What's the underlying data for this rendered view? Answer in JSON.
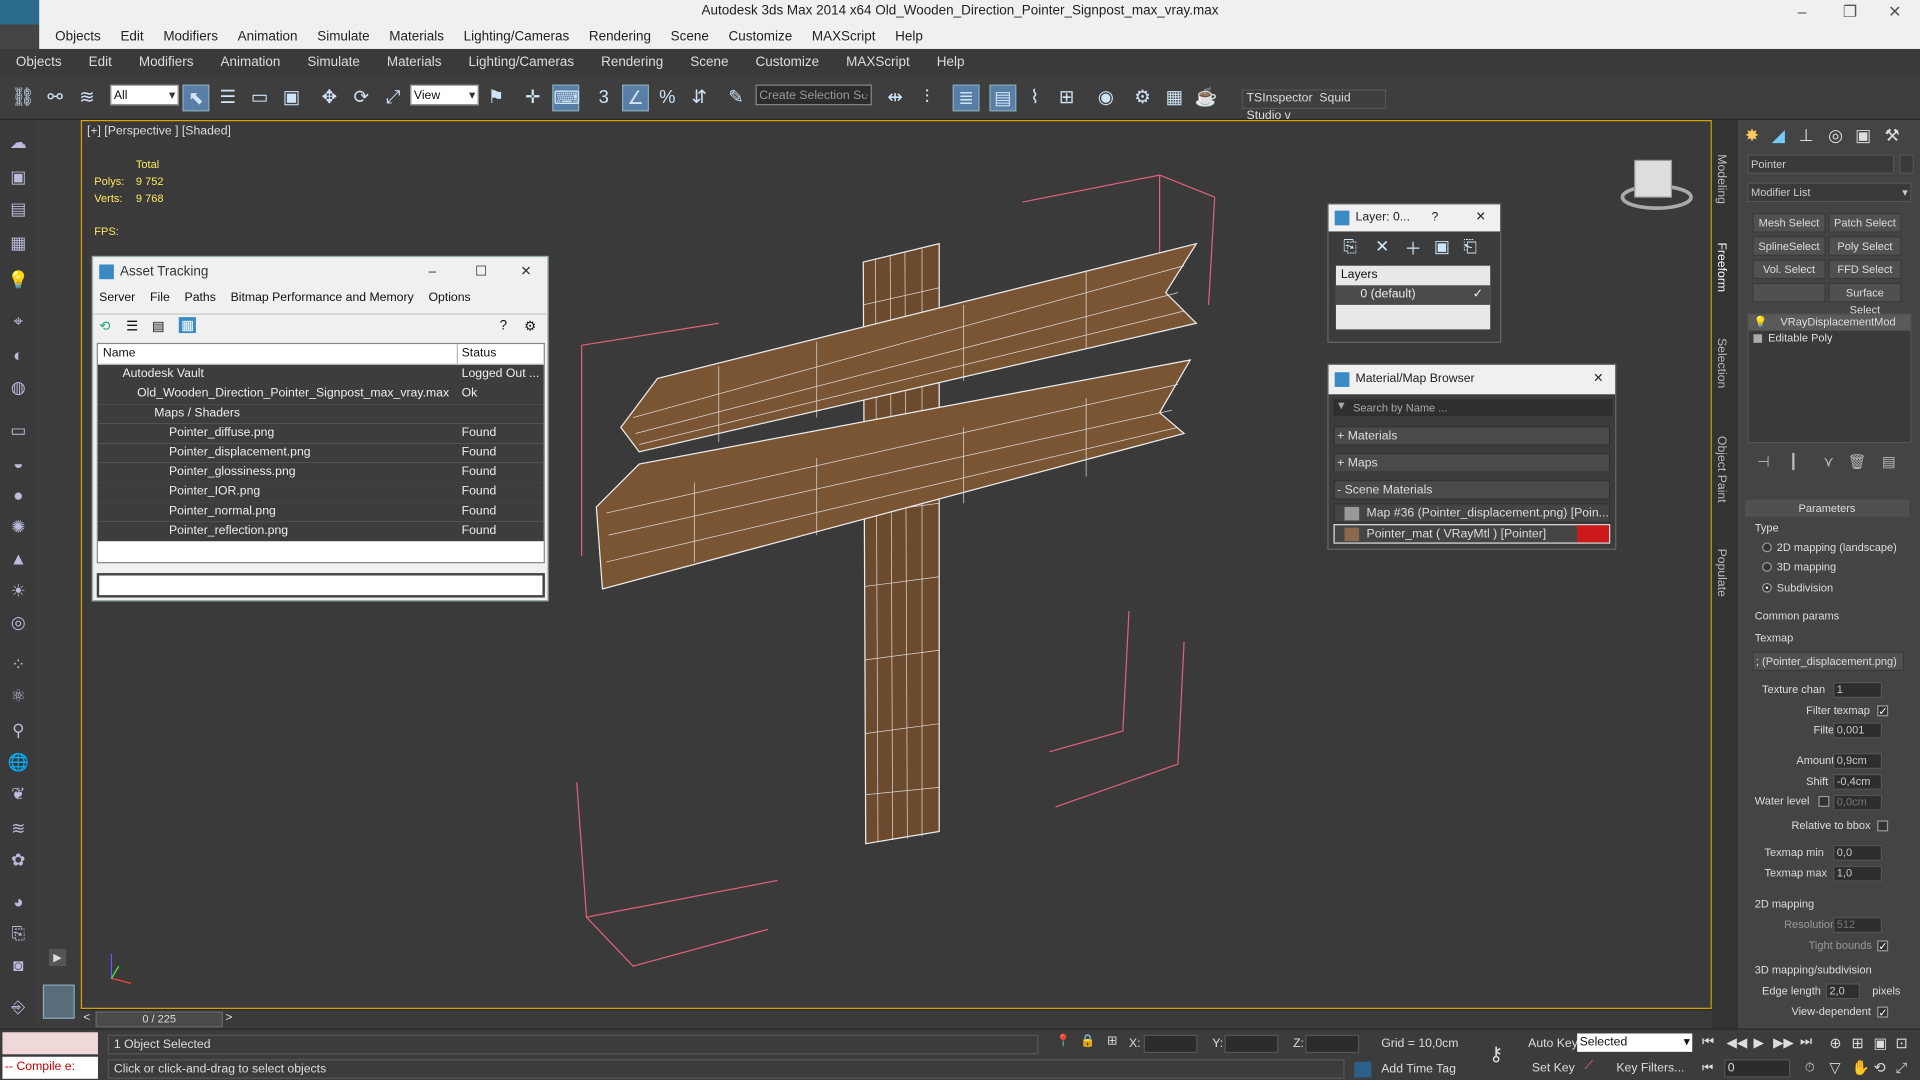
{
  "window": {
    "title": "Autodesk 3ds Max  2014 x64    Old_Wooden_Direction_Pointer_Signpost_max_vray.max"
  },
  "menu_top": [
    "Objects",
    "Edit",
    "Modifiers",
    "Animation",
    "Simulate",
    "Materials",
    "Lighting/Cameras",
    "Rendering",
    "Scene",
    "Customize",
    "MAXScript",
    "Help"
  ],
  "menu_main": [
    "Objects",
    "Edit",
    "Modifiers",
    "Animation",
    "Simulate",
    "Materials",
    "Lighting/Cameras",
    "Rendering",
    "Scene",
    "Customize",
    "MAXScript",
    "Help"
  ],
  "toolbar": {
    "filter_value": "All",
    "refcoord_value": "View",
    "selection_set_placeholder": "Create Selection Se",
    "tsinspector": "TSInspector",
    "squid": "Squid Studio v"
  },
  "viewport": {
    "label": "[+] [Perspective ] [Shaded]",
    "stats": {
      "total": "Total",
      "polys_label": "Polys:",
      "polys": "9 752",
      "verts_label": "Verts:",
      "verts": "9 768",
      "fps_label": "FPS:"
    }
  },
  "asset_tracking": {
    "title": "Asset Tracking",
    "menu": [
      "Server",
      "File",
      "Paths",
      "Bitmap Performance and Memory",
      "Options"
    ],
    "col_name": "Name",
    "col_status": "Status",
    "rows": [
      {
        "name": "Autodesk Vault",
        "status": "Logged Out ..."
      },
      {
        "name": "Old_Wooden_Direction_Pointer_Signpost_max_vray.max",
        "status": "Ok"
      },
      {
        "name": "Maps / Shaders",
        "status": ""
      },
      {
        "name": "Pointer_diffuse.png",
        "status": "Found"
      },
      {
        "name": "Pointer_displacement.png",
        "status": "Found"
      },
      {
        "name": "Pointer_glossiness.png",
        "status": "Found"
      },
      {
        "name": "Pointer_IOR.png",
        "status": "Found"
      },
      {
        "name": "Pointer_normal.png",
        "status": "Found"
      },
      {
        "name": "Pointer_reflection.png",
        "status": "Found"
      }
    ]
  },
  "layer_win": {
    "title": "Layer: 0...",
    "help": "?",
    "header": "Layers",
    "item": "0 (default)"
  },
  "mat_browser": {
    "title": "Material/Map Browser",
    "search_placeholder": "Search by Name ...",
    "groups": [
      "+ Materials",
      "+ Maps",
      "- Scene Materials"
    ],
    "items": [
      "Map #36 (Pointer_displacement.png) [Poin...",
      "Pointer_mat  ( VRayMtl ) [Pointer]"
    ]
  },
  "right_tabs": [
    "Modeling",
    "Freeform",
    "Selection",
    "Object Paint",
    "Populate"
  ],
  "cmd_panel": {
    "object_name": "Pointer",
    "modifier_list": "Modifier List",
    "buttons": [
      "Mesh Select",
      "Patch Select",
      "SplineSelect",
      "Poly Select",
      "Vol. Select",
      "FFD Select",
      "",
      "Surface Select"
    ],
    "stack": [
      "VRayDisplacementMod",
      "Editable Poly"
    ],
    "params_title": "Parameters",
    "type_label": "Type",
    "type_opts": [
      "2D mapping (landscape)",
      "3D mapping",
      "Subdivision"
    ],
    "common_label": "Common params",
    "texmap_label": "Texmap",
    "texmap_value": "; (Pointer_displacement.png)",
    "texture_chan_label": "Texture chan",
    "texture_chan": "1",
    "filter_texmap": "Filter texmap",
    "filter_blur_label": "Filter blur",
    "filter_blur": "0,001",
    "amount_label": "Amount",
    "amount": "0,9cm",
    "shift_label": "Shift",
    "shift": "-0,4cm",
    "water_label": "Water level",
    "water": "0,0cm",
    "relative_bbox": "Relative to bbox",
    "texmap_min_label": "Texmap min",
    "texmap_min": "0,0",
    "texmap_max_label": "Texmap max",
    "texmap_max": "1,0",
    "mapping2d_label": "2D mapping",
    "resolution_label": "Resolution",
    "resolution": "512",
    "tight_bounds": "Tight bounds",
    "mapping3d_label": "3D mapping/subdivision",
    "edge_length_label": "Edge length",
    "edge_length": "2,0",
    "pixels": "pixels",
    "view_dependent": "View-dependent"
  },
  "timeline": {
    "frame": "0 / 225"
  },
  "status": {
    "selected": "1 Object Selected",
    "prompt": "Click or click-and-drag to select objects",
    "maxscript": "-- Compile e:",
    "x_label": "X:",
    "y_label": "Y:",
    "z_label": "Z:",
    "grid": "Grid = 10,0cm",
    "add_time_tag": "Add Time Tag",
    "auto_key": "Auto Key",
    "set_key": "Set Key",
    "selected_combo": "Selected",
    "key_filters": "Key Filters...",
    "frame_field": "0"
  }
}
